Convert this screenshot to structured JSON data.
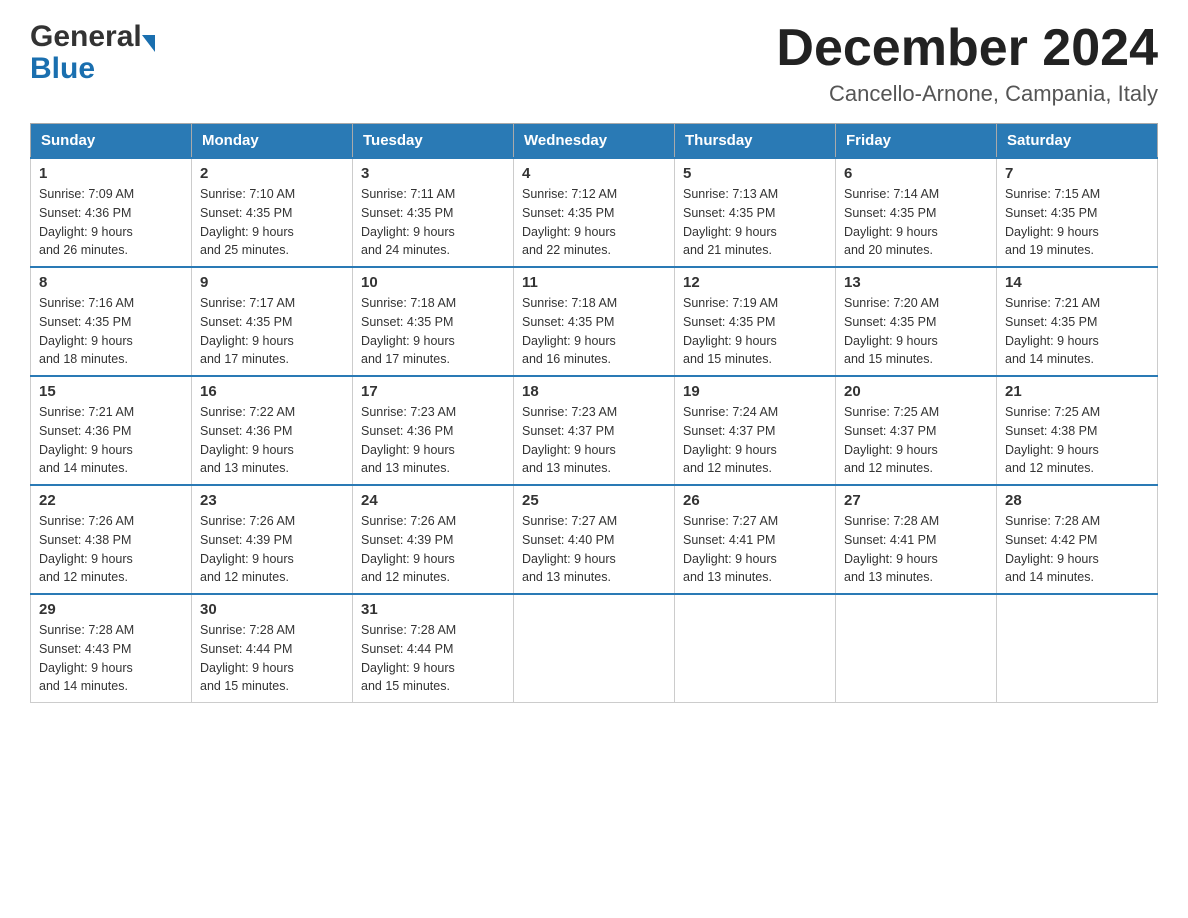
{
  "header": {
    "logo_general": "General",
    "logo_blue": "Blue",
    "month_title": "December 2024",
    "location": "Cancello-Arnone, Campania, Italy"
  },
  "days_of_week": [
    "Sunday",
    "Monday",
    "Tuesday",
    "Wednesday",
    "Thursday",
    "Friday",
    "Saturday"
  ],
  "weeks": [
    [
      {
        "day": "1",
        "sunrise": "7:09 AM",
        "sunset": "4:36 PM",
        "daylight": "9 hours and 26 minutes."
      },
      {
        "day": "2",
        "sunrise": "7:10 AM",
        "sunset": "4:35 PM",
        "daylight": "9 hours and 25 minutes."
      },
      {
        "day": "3",
        "sunrise": "7:11 AM",
        "sunset": "4:35 PM",
        "daylight": "9 hours and 24 minutes."
      },
      {
        "day": "4",
        "sunrise": "7:12 AM",
        "sunset": "4:35 PM",
        "daylight": "9 hours and 22 minutes."
      },
      {
        "day": "5",
        "sunrise": "7:13 AM",
        "sunset": "4:35 PM",
        "daylight": "9 hours and 21 minutes."
      },
      {
        "day": "6",
        "sunrise": "7:14 AM",
        "sunset": "4:35 PM",
        "daylight": "9 hours and 20 minutes."
      },
      {
        "day": "7",
        "sunrise": "7:15 AM",
        "sunset": "4:35 PM",
        "daylight": "9 hours and 19 minutes."
      }
    ],
    [
      {
        "day": "8",
        "sunrise": "7:16 AM",
        "sunset": "4:35 PM",
        "daylight": "9 hours and 18 minutes."
      },
      {
        "day": "9",
        "sunrise": "7:17 AM",
        "sunset": "4:35 PM",
        "daylight": "9 hours and 17 minutes."
      },
      {
        "day": "10",
        "sunrise": "7:18 AM",
        "sunset": "4:35 PM",
        "daylight": "9 hours and 17 minutes."
      },
      {
        "day": "11",
        "sunrise": "7:18 AM",
        "sunset": "4:35 PM",
        "daylight": "9 hours and 16 minutes."
      },
      {
        "day": "12",
        "sunrise": "7:19 AM",
        "sunset": "4:35 PM",
        "daylight": "9 hours and 15 minutes."
      },
      {
        "day": "13",
        "sunrise": "7:20 AM",
        "sunset": "4:35 PM",
        "daylight": "9 hours and 15 minutes."
      },
      {
        "day": "14",
        "sunrise": "7:21 AM",
        "sunset": "4:35 PM",
        "daylight": "9 hours and 14 minutes."
      }
    ],
    [
      {
        "day": "15",
        "sunrise": "7:21 AM",
        "sunset": "4:36 PM",
        "daylight": "9 hours and 14 minutes."
      },
      {
        "day": "16",
        "sunrise": "7:22 AM",
        "sunset": "4:36 PM",
        "daylight": "9 hours and 13 minutes."
      },
      {
        "day": "17",
        "sunrise": "7:23 AM",
        "sunset": "4:36 PM",
        "daylight": "9 hours and 13 minutes."
      },
      {
        "day": "18",
        "sunrise": "7:23 AM",
        "sunset": "4:37 PM",
        "daylight": "9 hours and 13 minutes."
      },
      {
        "day": "19",
        "sunrise": "7:24 AM",
        "sunset": "4:37 PM",
        "daylight": "9 hours and 12 minutes."
      },
      {
        "day": "20",
        "sunrise": "7:25 AM",
        "sunset": "4:37 PM",
        "daylight": "9 hours and 12 minutes."
      },
      {
        "day": "21",
        "sunrise": "7:25 AM",
        "sunset": "4:38 PM",
        "daylight": "9 hours and 12 minutes."
      }
    ],
    [
      {
        "day": "22",
        "sunrise": "7:26 AM",
        "sunset": "4:38 PM",
        "daylight": "9 hours and 12 minutes."
      },
      {
        "day": "23",
        "sunrise": "7:26 AM",
        "sunset": "4:39 PM",
        "daylight": "9 hours and 12 minutes."
      },
      {
        "day": "24",
        "sunrise": "7:26 AM",
        "sunset": "4:39 PM",
        "daylight": "9 hours and 12 minutes."
      },
      {
        "day": "25",
        "sunrise": "7:27 AM",
        "sunset": "4:40 PM",
        "daylight": "9 hours and 13 minutes."
      },
      {
        "day": "26",
        "sunrise": "7:27 AM",
        "sunset": "4:41 PM",
        "daylight": "9 hours and 13 minutes."
      },
      {
        "day": "27",
        "sunrise": "7:28 AM",
        "sunset": "4:41 PM",
        "daylight": "9 hours and 13 minutes."
      },
      {
        "day": "28",
        "sunrise": "7:28 AM",
        "sunset": "4:42 PM",
        "daylight": "9 hours and 14 minutes."
      }
    ],
    [
      {
        "day": "29",
        "sunrise": "7:28 AM",
        "sunset": "4:43 PM",
        "daylight": "9 hours and 14 minutes."
      },
      {
        "day": "30",
        "sunrise": "7:28 AM",
        "sunset": "4:44 PM",
        "daylight": "9 hours and 15 minutes."
      },
      {
        "day": "31",
        "sunrise": "7:28 AM",
        "sunset": "4:44 PM",
        "daylight": "9 hours and 15 minutes."
      },
      null,
      null,
      null,
      null
    ]
  ],
  "labels": {
    "sunrise": "Sunrise:",
    "sunset": "Sunset:",
    "daylight": "Daylight:"
  }
}
